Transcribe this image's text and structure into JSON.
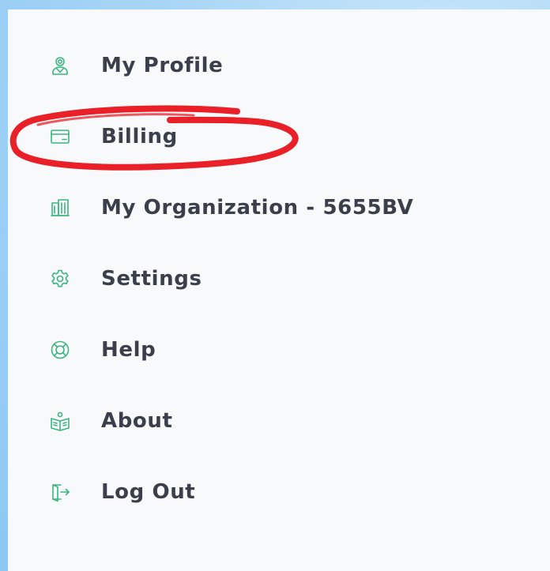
{
  "menu": {
    "items": [
      {
        "label": "My Profile",
        "icon": "user-profile-icon"
      },
      {
        "label": "Billing",
        "icon": "credit-card-icon"
      },
      {
        "label": "My Organization - 5655BV",
        "icon": "building-icon"
      },
      {
        "label": "Settings",
        "icon": "gear-icon"
      },
      {
        "label": "Help",
        "icon": "lifebuoy-icon"
      },
      {
        "label": "About",
        "icon": "open-book-icon"
      },
      {
        "label": "Log Out",
        "icon": "logout-door-icon"
      }
    ]
  },
  "colors": {
    "icon_accent": "#3bb67f",
    "label_text": "#3a3f4b",
    "panel_background": "#f8f9fa",
    "highlight_stroke": "#e8141c"
  }
}
